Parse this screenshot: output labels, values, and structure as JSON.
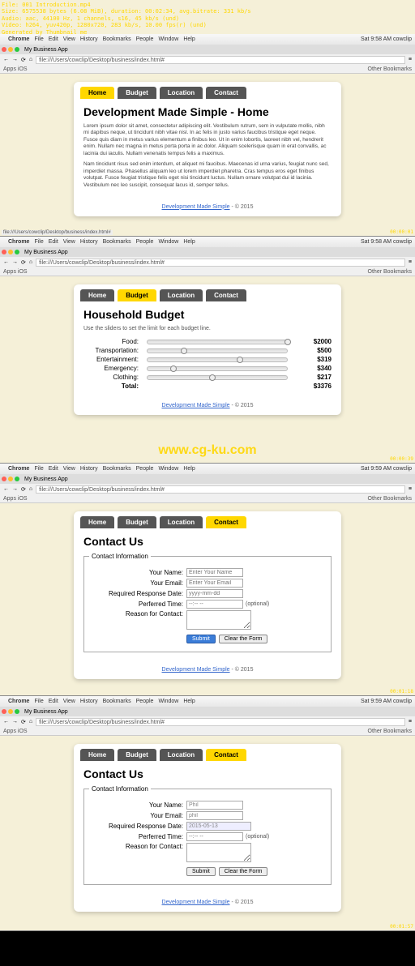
{
  "overlay": "File: 001 Introduction.mp4\nSize: 6575538 bytes (6.08 MiB), duration: 00:02:34, avg.bitrate: 331 kb/s\nAudio: aac, 44100 Hz, 1 channels, s16, 45 kb/s (und)\nVideo: h264, yuv420p, 1280x720, 283 kb/s, 10.00 fps(r) (und)\nGenerated by Thumbnail me",
  "watermark": "www.cg-ku.com",
  "panels": [
    {
      "menubar": {
        "app": "Chrome",
        "items": [
          "File",
          "Edit",
          "View",
          "History",
          "Bookmarks",
          "People",
          "Window",
          "Help"
        ],
        "right": "Sat 9:58 AM  cowclip"
      },
      "tab_title": "My Business App",
      "url": "file:///Users/cowclip/Desktop/business/index.html#",
      "bm_left": "Apps   iOS",
      "bm_right": "Other Bookmarks",
      "nav": {
        "items": [
          "Home",
          "Budget",
          "Location",
          "Contact"
        ],
        "active": 0
      },
      "page": {
        "title": "Development Made Simple - Home",
        "p1": "Lorem ipsum dolor sit amet, consectetur adipiscing elit. Vestibulum rutrum, sem in vulputate mollis, nibh mi dapibus neque, ut tincidunt nibh vitae nisl. In ac felis in justo varius faucibus tristique eget neque. Fusce quis diam in metus varius elementum a finibus leo. Ut in enim lobortis, laoreet nibh vel, hendrerit enim. Nullam nec magna in metus porta porta in ac dolor. Aliquam scelerisque quam in erat convallis, ac lacinia dui iaculis. Nullam venenatis tempus felis a maximus.",
        "p2": "Nam tincidunt risus sed enim interdum, et aliquet mi faucibus. Maecenas id urna varius, feugiat nunc sed, imperdiet massa. Phasellus aliquam leo ut lorem imperdiet pharetra. Cras tempus eros eget finibus volutpat. Fusce feugiat tristique felis eget nisi tincidunt luctus. Nullam ornare volutpat dui id lacinia. Vestibulum nec leo suscipit, consequat lacus id, semper tellus."
      },
      "footer": {
        "link": "Development Made Simple",
        "rest": " - © 2015"
      },
      "status_left": "file:///Users/cowclip/Desktop/business/index.html#",
      "tstamp": "00:00:01"
    },
    {
      "menubar": {
        "app": "Chrome",
        "items": [
          "File",
          "Edit",
          "View",
          "History",
          "Bookmarks",
          "People",
          "Window",
          "Help"
        ],
        "right": "Sat 9:58 AM  cowclip"
      },
      "tab_title": "My Business App",
      "url": "file:///Users/cowclip/Desktop/business/index.html#",
      "bm_left": "Apps   iOS",
      "bm_right": "Other Bookmarks",
      "nav": {
        "items": [
          "Home",
          "Budget",
          "Location",
          "Contact"
        ],
        "active": 1
      },
      "page": {
        "title": "Household Budget",
        "sub": "Use the sliders to set the limit for each budget line.",
        "rows": [
          {
            "label": "Food:",
            "val": "$2000",
            "pos": 98
          },
          {
            "label": "Transportation:",
            "val": "$500",
            "pos": 24
          },
          {
            "label": "Entertainment:",
            "val": "$319",
            "pos": 64
          },
          {
            "label": "Emergency:",
            "val": "$340",
            "pos": 16
          },
          {
            "label": "Clothing:",
            "val": "$217",
            "pos": 44
          }
        ],
        "total": {
          "label": "Total:",
          "val": "$3376"
        }
      },
      "footer": {
        "link": "Development Made Simple",
        "rest": " - © 2015"
      },
      "tstamp": "00:00:39"
    },
    {
      "menubar": {
        "app": "Chrome",
        "items": [
          "File",
          "Edit",
          "View",
          "History",
          "Bookmarks",
          "People",
          "Window",
          "Help"
        ],
        "right": "Sat 9:59 AM  cowclip"
      },
      "tab_title": "My Business App",
      "url": "file:///Users/cowclip/Desktop/business/index.html#",
      "bm_left": "Apps   iOS",
      "bm_right": "Other Bookmarks",
      "nav": {
        "items": [
          "Home",
          "Budget",
          "Location",
          "Contact"
        ],
        "active": 3
      },
      "page": {
        "title": "Contact Us",
        "legend": "Contact Information",
        "fields": {
          "name": {
            "label": "Your Name:",
            "ph": "Enter Your Name"
          },
          "email": {
            "label": "Your Email:",
            "ph": "Enter Your Email"
          },
          "date": {
            "label": "Required Response Date:",
            "ph": "yyyy-mm-dd"
          },
          "time": {
            "label": "Perferred Time:",
            "ph": "--:-- --",
            "opt": "(optional)"
          },
          "reason": {
            "label": "Reason for Contact:"
          }
        },
        "buttons": {
          "submit": "Submit",
          "clear": "Clear the Form"
        }
      },
      "footer": {
        "link": "Development Made Simple",
        "rest": " - © 2015"
      },
      "tstamp": "00:01:18"
    },
    {
      "menubar": {
        "app": "Chrome",
        "items": [
          "File",
          "Edit",
          "View",
          "History",
          "Bookmarks",
          "People",
          "Window",
          "Help"
        ],
        "right": "Sat 9:59 AM  cowclip"
      },
      "tab_title": "My Business App",
      "url": "file:///Users/cowclip/Desktop/business/index.html#",
      "bm_left": "Apps   iOS",
      "bm_right": "Other Bookmarks",
      "nav": {
        "items": [
          "Home",
          "Budget",
          "Location",
          "Contact"
        ],
        "active": 3
      },
      "page": {
        "title": "Contact Us",
        "legend": "Contact Information",
        "fields": {
          "name": {
            "label": "Your Name:",
            "val": "Phil"
          },
          "email": {
            "label": "Your Email:",
            "val": "phil"
          },
          "date": {
            "label": "Required Response Date:",
            "val": "2015-05-13"
          },
          "time": {
            "label": "Perferred Time:",
            "ph": "--:-- --",
            "opt": "(optional)"
          },
          "reason": {
            "label": "Reason for Contact:"
          }
        },
        "buttons": {
          "submit": "Submit",
          "clear": "Clear the Form"
        }
      },
      "footer": {
        "link": "Development Made Simple",
        "rest": " - © 2015"
      },
      "tstamp": "00:01:57"
    }
  ]
}
